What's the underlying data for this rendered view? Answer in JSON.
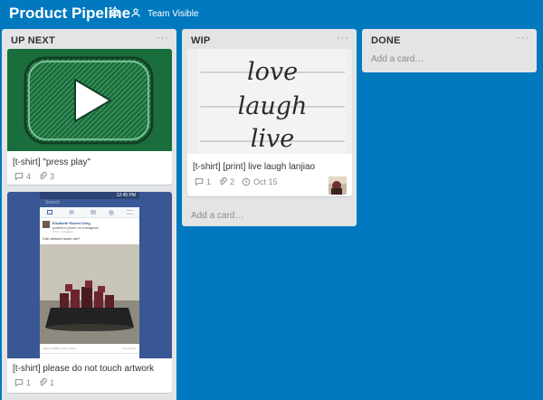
{
  "header": {
    "title": "Product Pipeline",
    "team_label": "Team Visible"
  },
  "lists": {
    "upnext": {
      "title": "UP NEXT",
      "cards": [
        {
          "title": "[t-shirt] \"press play\"",
          "comments": "4",
          "attachments": "3"
        },
        {
          "title": "[t-shirt] please do not touch artwork",
          "comments": "1",
          "attachments": "1"
        }
      ]
    },
    "wip": {
      "title": "WIP",
      "cards": [
        {
          "title": "[t-shirt] [print] live laugh lanjiao",
          "comments": "1",
          "attachments": "2",
          "due": "Oct 15",
          "cover_words": [
            "love",
            "laugh",
            "live"
          ]
        }
      ],
      "add_card": "Add a card…"
    },
    "done": {
      "title": "DONE",
      "add_card": "Add a card…"
    }
  },
  "phone_screenshot": {
    "status_time": "12:45 PM",
    "search_placeholder": "Search",
    "post_author": "Elizabeth Rachel Ding",
    "post_action": "posted a photo on Instagram",
    "post_meta": "4 hrs · Instagram ·",
    "post_text": "Can artwork touch me?",
    "footer_text": "Bianca Walsh and 4 others",
    "footer_count": "1 Comment"
  },
  "colors": {
    "board_bg": "#0179bf",
    "list_bg": "#e2e4e6",
    "play_cover_bg": "#1e7a43",
    "phone_frame_bg": "#3a5795"
  }
}
